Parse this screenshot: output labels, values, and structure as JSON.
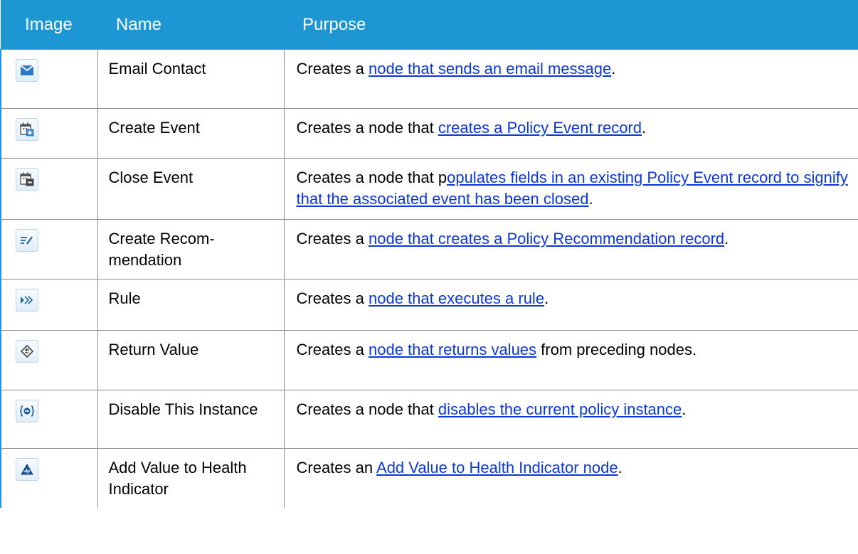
{
  "table": {
    "headers": {
      "image": "Image",
      "name": "Name",
      "purpose": "Purpose"
    },
    "rows": [
      {
        "icon": "envelope-icon",
        "name": "Email Contact",
        "purpose_pre": "Creates a ",
        "purpose_link": "node that sends an email message",
        "purpose_post": "."
      },
      {
        "icon": "calendar-add-icon",
        "name": "Create Event",
        "purpose_pre": "Creates a node that ",
        "purpose_link": "creates a Policy Event record",
        "purpose_post": "."
      },
      {
        "icon": "calendar-remove-icon",
        "name": "Close Event",
        "purpose_pre": "Creates a node that p",
        "purpose_link": "opulates fields in an existing Policy Event record to signify that the associated event has been closed",
        "purpose_post": "."
      },
      {
        "icon": "pencil-lines-icon",
        "name": "Create Recom-mendation",
        "purpose_pre": "Creates a ",
        "purpose_link": "node that creates a Policy Recommendation record",
        "purpose_post": "."
      },
      {
        "icon": "chevrons-right-icon",
        "name": "Rule",
        "purpose_pre": "Creates a ",
        "purpose_link": "node that executes a rule",
        "purpose_post": "."
      },
      {
        "icon": "return-diamond-icon",
        "name": "Return Value",
        "purpose_pre": "Creates a ",
        "purpose_link": "node that returns values",
        "purpose_post": " from preceding nodes."
      },
      {
        "icon": "disable-braces-icon",
        "name": "Disable This Instance",
        "purpose_pre": "Creates a node that ",
        "purpose_link": "disables the current policy instance",
        "purpose_post": "."
      },
      {
        "icon": "health-indicator-icon",
        "name": "Add Value to Health Indicator",
        "purpose_pre": "Creates an ",
        "purpose_link": "Add Value to Health Indicator node",
        "purpose_post": "."
      }
    ]
  },
  "colors": {
    "header_bg": "#1d96d3",
    "link": "#0a37d8",
    "border": "#8c8c8c"
  }
}
